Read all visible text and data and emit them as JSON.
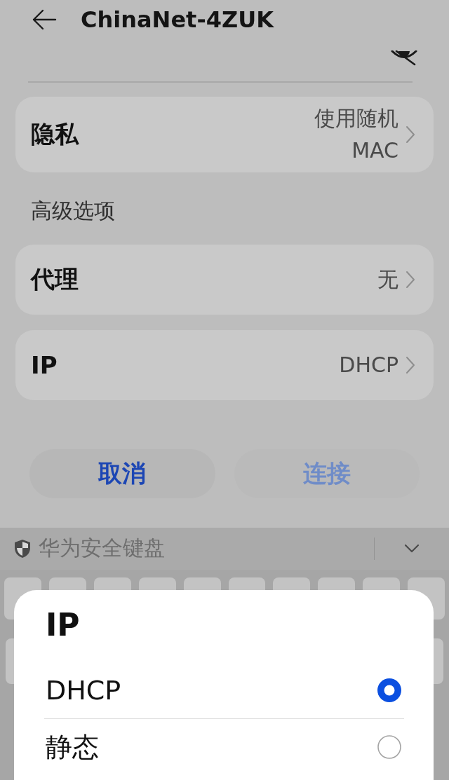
{
  "header": {
    "title": "ChinaNet-4ZUK"
  },
  "privacy": {
    "label": "隐私",
    "value": "使用随机 MAC"
  },
  "advanced": {
    "title": "高级选项",
    "rows": [
      {
        "label": "代理",
        "value": "无"
      },
      {
        "label": "IP",
        "value": "DHCP"
      }
    ]
  },
  "buttons": [
    {
      "label": "取消",
      "disabled": false
    },
    {
      "label": "连接",
      "disabled": true
    }
  ],
  "keyboard": {
    "title": "华为安全键盘"
  },
  "ip_sheet": {
    "title": "IP",
    "options": [
      {
        "label": "DHCP",
        "selected": true
      },
      {
        "label": "静态",
        "selected": false
      }
    ]
  }
}
